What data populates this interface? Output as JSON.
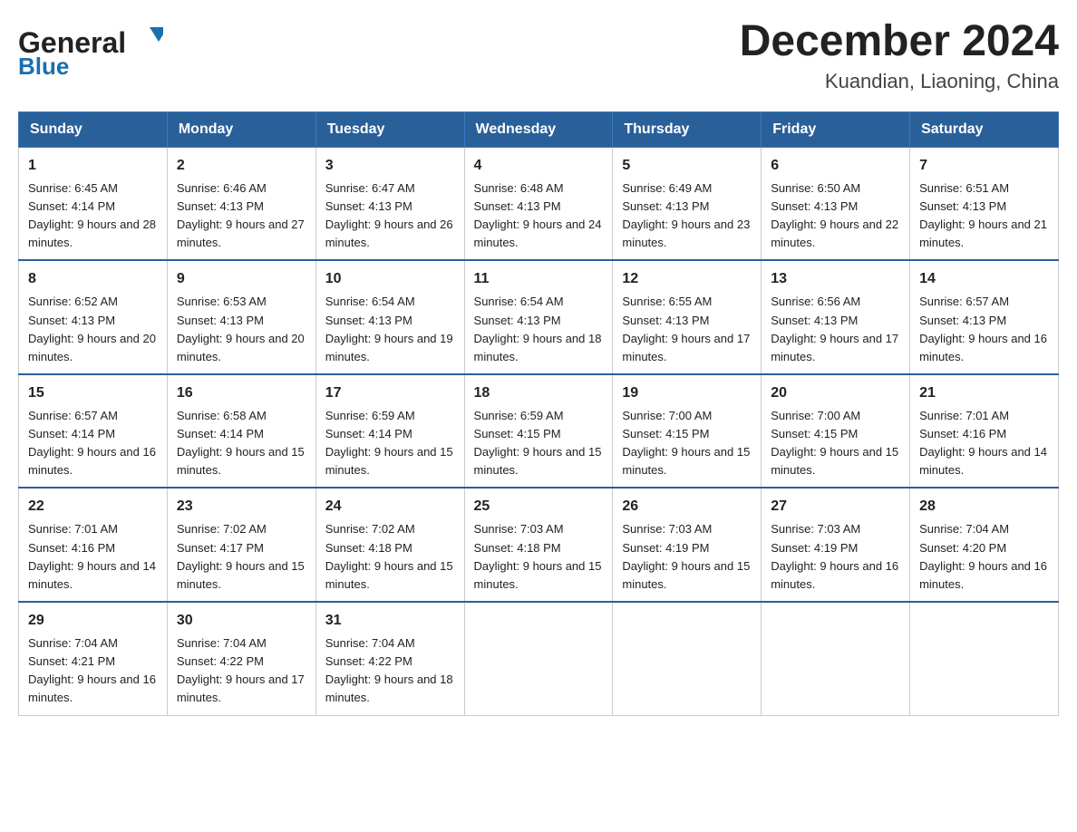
{
  "header": {
    "logo_general": "General",
    "logo_blue": "Blue",
    "month_year": "December 2024",
    "location": "Kuandian, Liaoning, China"
  },
  "days_of_week": [
    "Sunday",
    "Monday",
    "Tuesday",
    "Wednesday",
    "Thursday",
    "Friday",
    "Saturday"
  ],
  "weeks": [
    [
      {
        "day": "1",
        "sunrise": "6:45 AM",
        "sunset": "4:14 PM",
        "daylight": "9 hours and 28 minutes."
      },
      {
        "day": "2",
        "sunrise": "6:46 AM",
        "sunset": "4:13 PM",
        "daylight": "9 hours and 27 minutes."
      },
      {
        "day": "3",
        "sunrise": "6:47 AM",
        "sunset": "4:13 PM",
        "daylight": "9 hours and 26 minutes."
      },
      {
        "day": "4",
        "sunrise": "6:48 AM",
        "sunset": "4:13 PM",
        "daylight": "9 hours and 24 minutes."
      },
      {
        "day": "5",
        "sunrise": "6:49 AM",
        "sunset": "4:13 PM",
        "daylight": "9 hours and 23 minutes."
      },
      {
        "day": "6",
        "sunrise": "6:50 AM",
        "sunset": "4:13 PM",
        "daylight": "9 hours and 22 minutes."
      },
      {
        "day": "7",
        "sunrise": "6:51 AM",
        "sunset": "4:13 PM",
        "daylight": "9 hours and 21 minutes."
      }
    ],
    [
      {
        "day": "8",
        "sunrise": "6:52 AM",
        "sunset": "4:13 PM",
        "daylight": "9 hours and 20 minutes."
      },
      {
        "day": "9",
        "sunrise": "6:53 AM",
        "sunset": "4:13 PM",
        "daylight": "9 hours and 20 minutes."
      },
      {
        "day": "10",
        "sunrise": "6:54 AM",
        "sunset": "4:13 PM",
        "daylight": "9 hours and 19 minutes."
      },
      {
        "day": "11",
        "sunrise": "6:54 AM",
        "sunset": "4:13 PM",
        "daylight": "9 hours and 18 minutes."
      },
      {
        "day": "12",
        "sunrise": "6:55 AM",
        "sunset": "4:13 PM",
        "daylight": "9 hours and 17 minutes."
      },
      {
        "day": "13",
        "sunrise": "6:56 AM",
        "sunset": "4:13 PM",
        "daylight": "9 hours and 17 minutes."
      },
      {
        "day": "14",
        "sunrise": "6:57 AM",
        "sunset": "4:13 PM",
        "daylight": "9 hours and 16 minutes."
      }
    ],
    [
      {
        "day": "15",
        "sunrise": "6:57 AM",
        "sunset": "4:14 PM",
        "daylight": "9 hours and 16 minutes."
      },
      {
        "day": "16",
        "sunrise": "6:58 AM",
        "sunset": "4:14 PM",
        "daylight": "9 hours and 15 minutes."
      },
      {
        "day": "17",
        "sunrise": "6:59 AM",
        "sunset": "4:14 PM",
        "daylight": "9 hours and 15 minutes."
      },
      {
        "day": "18",
        "sunrise": "6:59 AM",
        "sunset": "4:15 PM",
        "daylight": "9 hours and 15 minutes."
      },
      {
        "day": "19",
        "sunrise": "7:00 AM",
        "sunset": "4:15 PM",
        "daylight": "9 hours and 15 minutes."
      },
      {
        "day": "20",
        "sunrise": "7:00 AM",
        "sunset": "4:15 PM",
        "daylight": "9 hours and 15 minutes."
      },
      {
        "day": "21",
        "sunrise": "7:01 AM",
        "sunset": "4:16 PM",
        "daylight": "9 hours and 14 minutes."
      }
    ],
    [
      {
        "day": "22",
        "sunrise": "7:01 AM",
        "sunset": "4:16 PM",
        "daylight": "9 hours and 14 minutes."
      },
      {
        "day": "23",
        "sunrise": "7:02 AM",
        "sunset": "4:17 PM",
        "daylight": "9 hours and 15 minutes."
      },
      {
        "day": "24",
        "sunrise": "7:02 AM",
        "sunset": "4:18 PM",
        "daylight": "9 hours and 15 minutes."
      },
      {
        "day": "25",
        "sunrise": "7:03 AM",
        "sunset": "4:18 PM",
        "daylight": "9 hours and 15 minutes."
      },
      {
        "day": "26",
        "sunrise": "7:03 AM",
        "sunset": "4:19 PM",
        "daylight": "9 hours and 15 minutes."
      },
      {
        "day": "27",
        "sunrise": "7:03 AM",
        "sunset": "4:19 PM",
        "daylight": "9 hours and 16 minutes."
      },
      {
        "day": "28",
        "sunrise": "7:04 AM",
        "sunset": "4:20 PM",
        "daylight": "9 hours and 16 minutes."
      }
    ],
    [
      {
        "day": "29",
        "sunrise": "7:04 AM",
        "sunset": "4:21 PM",
        "daylight": "9 hours and 16 minutes."
      },
      {
        "day": "30",
        "sunrise": "7:04 AM",
        "sunset": "4:22 PM",
        "daylight": "9 hours and 17 minutes."
      },
      {
        "day": "31",
        "sunrise": "7:04 AM",
        "sunset": "4:22 PM",
        "daylight": "9 hours and 18 minutes."
      },
      null,
      null,
      null,
      null
    ]
  ]
}
